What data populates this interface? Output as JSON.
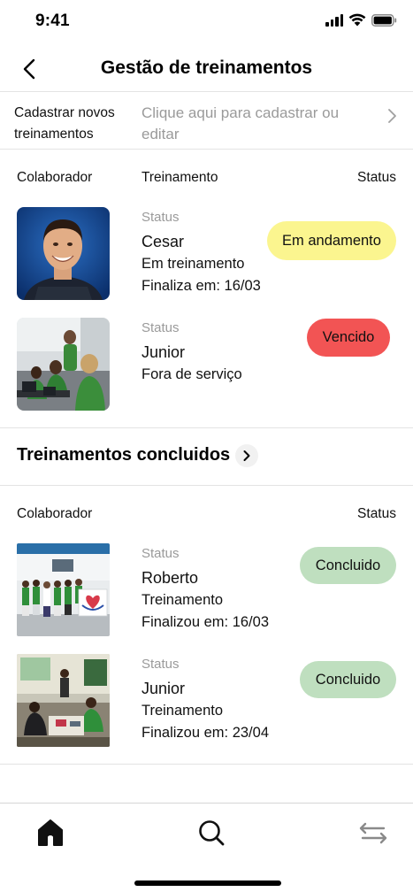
{
  "status_bar": {
    "time": "9:41"
  },
  "header": {
    "title": "Gestão de treinamentos",
    "back_icon": "chevron-left-icon"
  },
  "register": {
    "label": "Cadastrar novos treinamentos",
    "hint": "Clique aqui para cadastrar ou editar"
  },
  "active": {
    "columns": {
      "collaborator": "Colaborador",
      "training": "Treinamento",
      "status": "Status"
    },
    "rows": [
      {
        "label": "Status",
        "name": "Cesar",
        "line1": "Em treinamento",
        "line2": "Finaliza em: 16/03",
        "badge": "Em andamento",
        "badge_color": "#fbf58f"
      },
      {
        "label": "Status",
        "name": "Junior",
        "line1": "Fora de serviço",
        "badge": "Vencido",
        "badge_color": "#f25454"
      }
    ]
  },
  "completed": {
    "title": "Treinamentos concluidos",
    "columns": {
      "collaborator": "Colaborador",
      "status": "Status"
    },
    "rows": [
      {
        "label": "Status",
        "name": "Roberto",
        "line1": "Treinamento",
        "line2": "Finalizou em: 16/03",
        "badge": "Concluido",
        "badge_color": "#bfdfbf"
      },
      {
        "label": "Status",
        "name": "Junior",
        "line1": "Treinamento",
        "line2": "Finalizou em: 23/04",
        "badge": "Concluido",
        "badge_color": "#bfdfbf"
      }
    ]
  },
  "tabbar": {
    "items": [
      "home-icon",
      "search-icon",
      "swap-arrows-icon"
    ]
  }
}
